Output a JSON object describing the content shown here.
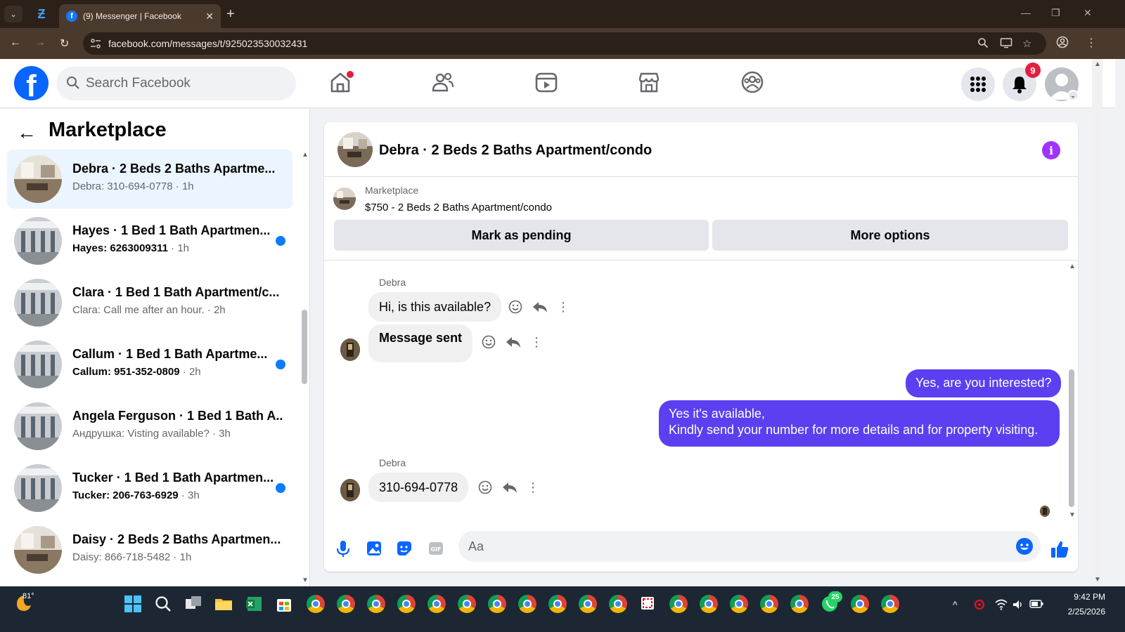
{
  "browser": {
    "tab_title": "(9) Messenger | Facebook",
    "url": "facebook.com/messages/t/925023530032431",
    "icons": [
      "tab-list-icon",
      "back-icon",
      "forward-icon",
      "reload-icon",
      "site-info-icon",
      "zoom-icon",
      "cast-icon",
      "bookmark-star-icon",
      "profile-icon",
      "menu-icon"
    ]
  },
  "header": {
    "search_placeholder": "Search Facebook",
    "notification_count": "9",
    "nav_icons": [
      "home-icon",
      "friends-icon",
      "watch-icon",
      "marketplace-icon",
      "groups-icon"
    ]
  },
  "sidebar": {
    "title": "Marketplace",
    "conversations": [
      {
        "title": "Debra · 2 Beds 2 Baths Apartme...",
        "preview": "Debra: 310-694-0778",
        "time": "1h",
        "unread": false,
        "active": true
      },
      {
        "title": "Hayes · 1 Bed 1 Bath Apartmen...",
        "preview": "Hayes: 6263009311",
        "time": "1h",
        "unread": true,
        "active": false
      },
      {
        "title": "Clara · 1 Bed 1 Bath Apartment/c...",
        "preview": "Clara: Call me after an hour.",
        "time": "2h",
        "unread": false,
        "active": false
      },
      {
        "title": "Callum · 1 Bed 1 Bath Apartme...",
        "preview": "Callum: 951-352-0809",
        "time": "2h",
        "unread": true,
        "active": false
      },
      {
        "title": "Angela Ferguson · 1 Bed 1 Bath A...",
        "preview": "Андрушка: Visting available?",
        "time": "3h",
        "unread": false,
        "active": false
      },
      {
        "title": "Tucker · 1 Bed 1 Bath Apartmen...",
        "preview": "Tucker: 206-763-6929",
        "time": "3h",
        "unread": true,
        "active": false
      },
      {
        "title": "Daisy · 2 Beds 2 Baths Apartmen...",
        "preview": "Daisy: 866-718-5482",
        "time": "1h",
        "unread": false,
        "active": false
      }
    ]
  },
  "chat": {
    "title": "Debra · 2 Beds 2 Baths Apartment/condo",
    "listing_label": "Marketplace",
    "listing_price": "$750 - 2 Beds 2 Baths Apartment/condo",
    "mark_pending": "Mark as pending",
    "more_options": "More options",
    "messages": [
      {
        "sender": "Debra",
        "text": "Hi, is this available?",
        "direction": "in"
      },
      {
        "sender": "",
        "text": "Message sent",
        "direction": "in"
      },
      {
        "sender": "",
        "text": "Yes, are you interested?",
        "direction": "out"
      },
      {
        "sender": "",
        "lines": [
          "Yes it's available,",
          "Kindly send your number for more details and for property visiting."
        ],
        "direction": "out"
      },
      {
        "sender": "Debra",
        "text": "310-694-0778",
        "direction": "in"
      }
    ],
    "composer_placeholder": "Aa"
  },
  "taskbar": {
    "weather_temp": "81°",
    "whatsapp_badge": "25",
    "time": "9:42 PM",
    "date": "2/25/2026"
  },
  "colors": {
    "fb_blue": "#0866ff",
    "outgoing_bubble": "#5b3ff0",
    "active_conversation": "#ebf5ff",
    "unread_dot": "#0a7cff",
    "badge_red": "#e41e3f",
    "info_purple": "#a033ff"
  }
}
